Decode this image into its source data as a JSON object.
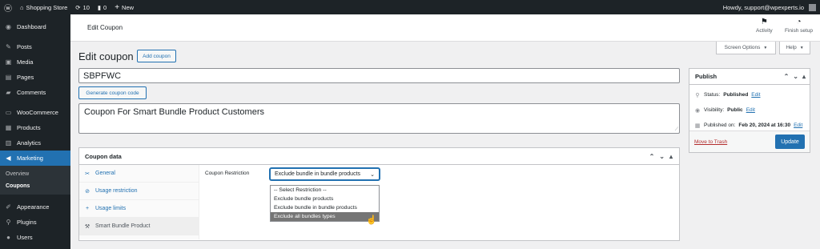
{
  "admin_bar": {
    "site_name": "Shopping Store",
    "updates_count": "10",
    "comments_count": "0",
    "new_label": "New",
    "greeting": "Howdy, support@wpexperts.io"
  },
  "sidebar": {
    "items": [
      {
        "label": "Dashboard",
        "icon": "dashboard-icon"
      },
      {
        "label": "Posts",
        "icon": "pin-icon"
      },
      {
        "label": "Media",
        "icon": "media-icon"
      },
      {
        "label": "Pages",
        "icon": "page-icon"
      },
      {
        "label": "Comments",
        "icon": "comment-icon"
      },
      {
        "label": "WooCommerce",
        "icon": "woo-icon"
      },
      {
        "label": "Products",
        "icon": "products-icon"
      },
      {
        "label": "Analytics",
        "icon": "analytics-icon"
      },
      {
        "label": "Marketing",
        "icon": "megaphone-icon"
      },
      {
        "label": "Appearance",
        "icon": "brush-icon"
      },
      {
        "label": "Plugins",
        "icon": "plugin-icon"
      },
      {
        "label": "Users",
        "icon": "user-icon"
      }
    ],
    "submenu": [
      "Overview",
      "Coupons"
    ]
  },
  "header": {
    "title": "Edit Coupon",
    "activity_label": "Activity",
    "finish_setup_label": "Finish setup",
    "screen_options_label": "Screen Options",
    "help_label": "Help"
  },
  "page": {
    "title": "Edit coupon",
    "add_coupon_label": "Add coupon",
    "coupon_code": "SBPFWC",
    "generate_label": "Generate coupon code",
    "description": "Coupon For Smart Bundle Product Customers"
  },
  "coupon_data": {
    "title": "Coupon data",
    "tabs": [
      {
        "label": "General",
        "icon": "ticket-icon"
      },
      {
        "label": "Usage restriction",
        "icon": "block-icon"
      },
      {
        "label": "Usage limits",
        "icon": "plus-icon"
      },
      {
        "label": "Smart Bundle Product",
        "icon": "wrench-icon"
      }
    ],
    "restriction_label": "Coupon Restriction",
    "selected_value": "Exclude bundle in bundle products",
    "options": [
      "-- Select Restriction --",
      "Exclude bundle products",
      "Exclude bundle in bundle products",
      "Exclude all bundles types"
    ]
  },
  "publish": {
    "title": "Publish",
    "status_label": "Status:",
    "status_value": "Published",
    "visibility_label": "Visibility:",
    "visibility_value": "Public",
    "published_label": "Published on:",
    "published_value": "Feb 20, 2024 at 16:30",
    "edit_label": "Edit",
    "trash_label": "Move to Trash",
    "update_label": "Update"
  },
  "colors": {
    "accent": "#2271b1",
    "admin_dark": "#1d2327",
    "trash": "#b32d2e"
  }
}
